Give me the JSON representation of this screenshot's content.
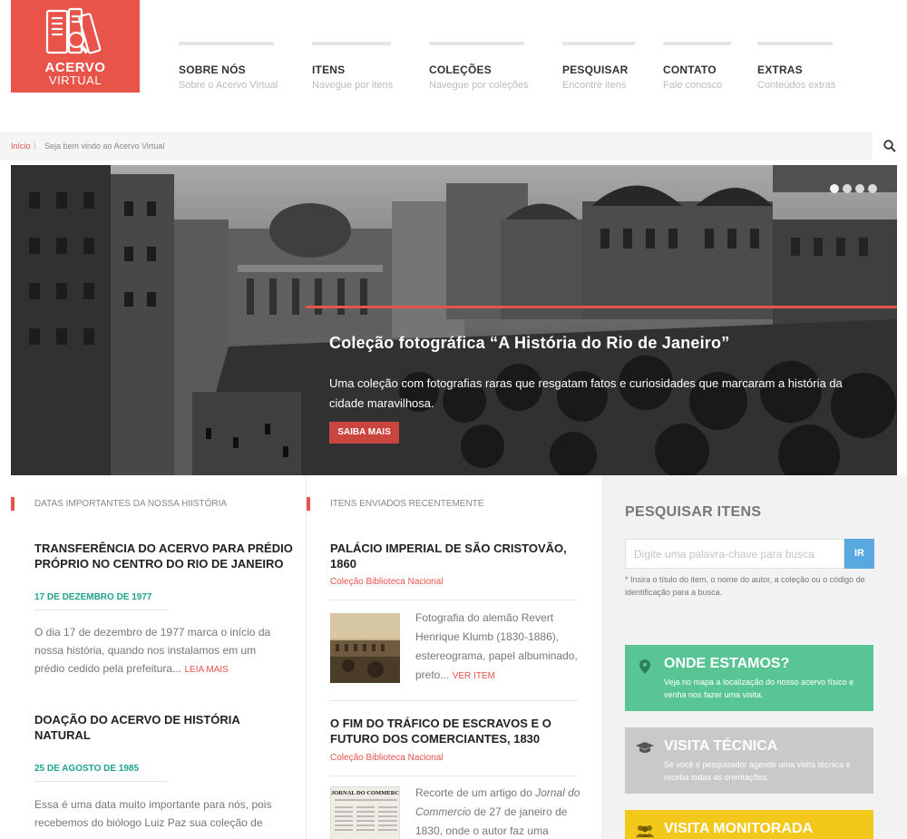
{
  "brand": {
    "line1": "ACERVO",
    "line2": "VIRTUAL",
    "color": "#e8534a"
  },
  "nav": [
    {
      "title": "SOBRE NÓS",
      "subtitle": "Sobre o Acervo Virtual"
    },
    {
      "title": "ITENS",
      "subtitle": "Navegue por itens"
    },
    {
      "title": "COLEÇÕES",
      "subtitle": "Navegue por coleções"
    },
    {
      "title": "PESQUISAR",
      "subtitle": "Encontre itens"
    },
    {
      "title": "CONTATO",
      "subtitle": "Fale conosco"
    },
    {
      "title": "EXTRAS",
      "subtitle": "Conteúdos extras"
    }
  ],
  "breadcrumb": {
    "home": "Início",
    "separator": "|",
    "message": "Seja bem vindo ao Acervo Virtual"
  },
  "hero": {
    "title": "Coleção fotográfica “A História do Rio de Janeiro”",
    "description": "Uma coleção com fotografias raras que resgatam fatos e curiosidades que marcaram a história da cidade maravilhosa.",
    "button": "SAIBA MAIS",
    "slides": 4,
    "active_slide": 1
  },
  "dates_section": {
    "heading": "DATAS IMPORTANTES DA NOSSA HIISTÓRIA",
    "events": [
      {
        "title": "TRANSFERÊNCIA DO ACERVO PARA PRÉDIO PRÓPRIO NO CENTRO DO RIO DE JANEIRO",
        "date": "17 DE DEZEMBRO DE 1977",
        "text": "O dia 17 de dezembro de 1977 marca o início da nossa história, quando nos instalamos em um prédio cedido pela prefeitura...",
        "more": "LEIA MAIS"
      },
      {
        "title": "DOAÇÃO DO ACERVO DE HISTÓRIA NATURAL",
        "date": "25 DE AGOSTO DE 1985",
        "text": "Essa é uma data muito importante para nós, pois recebemos do biólogo Luiz Paz sua coleção de",
        "more": ""
      }
    ]
  },
  "items_section": {
    "heading": "ITENS ENVIADOS RECENTEMENTE",
    "items": [
      {
        "title": "PALÁCIO IMPERIAL DE SÃO CRISTOVÃO, 1860",
        "collection": "Coleção Biblioteca Nacional",
        "text": "Fotografia do alemão Revert Henrique Klumb (1830-1886), estereograma, papel albuminado, preto...",
        "more": "VER ITEM"
      },
      {
        "title": "O FIM DO TRÁFICO DE ESCRAVOS E O FUTURO DOS COMERCIANTES, 1830",
        "collection": "Coleção Biblioteca Nacional",
        "text_pre": "Recorte de um artigo do ",
        "text_em": "Jornal do Commercio",
        "text_post": " de 27 de janeiro de 1830, onde o autor faz uma",
        "thumb_header": "JORNAL DO COMMERCIO."
      }
    ]
  },
  "search_panel": {
    "title": "PESQUISAR ITENS",
    "placeholder": "Digite uma palavra-chave para busca",
    "button": "IR",
    "hint": "* Insira o título do item, o nome do autor, a coleção ou o código de identificação para a busca."
  },
  "cards": [
    {
      "title": "ONDE ESTAMOS?",
      "text": "Veja no mapa a localização do nosso acervo físico e venha nos fazer uma visita.",
      "icon": "map-pin-icon",
      "color": "#5ac594"
    },
    {
      "title": "VISITA TÉCNICA",
      "text": "Se você é pesquisador agende uma visita técnica e receba todas as orientações.",
      "icon": "graduation-cap-icon",
      "color": "#c9c9c9"
    },
    {
      "title": "VISITA MONITORADA",
      "text": "",
      "icon": "group-icon",
      "color": "#f2c81a"
    }
  ]
}
